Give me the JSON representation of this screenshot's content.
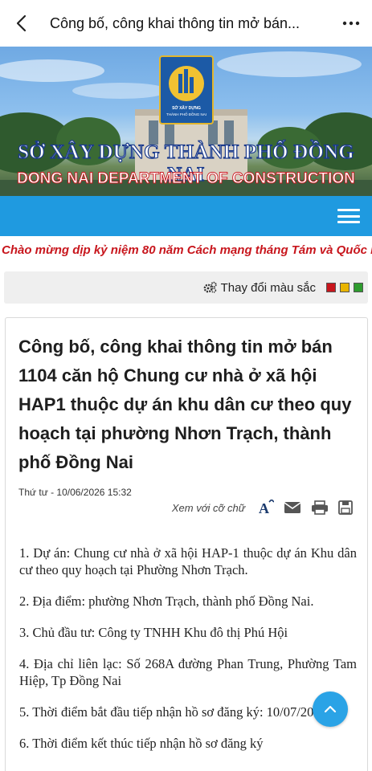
{
  "appbar": {
    "title": "Công bố, công khai thông tin mở bán...",
    "back_icon": "chevron-left-icon",
    "more_icon": "more-horizontal-icon"
  },
  "banner": {
    "logo_text": "SỞ XÂY DỰNG THÀNH PHỐ ĐỒNG NAI",
    "title_vn": "SỞ XÂY DỰNG THÀNH PHỐ ĐỒNG NAI",
    "title_en": "DONG NAI DEPARTMENT OF CONSTRUCTION"
  },
  "navbar": {
    "menu_icon": "hamburger-menu-icon"
  },
  "marquee": {
    "text": "Chào mừng dịp kỷ niệm 80 năm Cách mạng tháng Tám và Quốc l"
  },
  "color_bar": {
    "label": "Thay đổi màu sắc",
    "swatches": [
      "#c8161d",
      "#e8b400",
      "#2e9c2e"
    ]
  },
  "article": {
    "title": "Công bố, công khai thông tin mở bán 1104 căn hộ Chung cư nhà ở xã hội HAP1 thuộc dự án khu dân cư theo quy hoạch tại phường Nhơn Trạch, thành phố Đồng Nai",
    "date": "Thứ tư - 10/06/2026 15:32",
    "font_size_label": "Xem với cỡ chữ",
    "paragraphs": [
      "1. Dự án: Chung cư nhà ở xã hội HAP-1 thuộc dự án Khu dân cư theo quy hoạch tại Phường Nhơn Trạch.",
      "2. Địa điểm: phường Nhơn Trạch, thành phố Đồng Nai.",
      "3. Chủ đầu tư: Công ty TNHH Khu đô thị Phú Hội",
      "4. Địa chỉ liên lạc: Số 268A đường Phan Trung, Phường Tam Hiệp, Tp Đồng Nai",
      "5. Thời điểm bắt đầu tiếp nhận hồ sơ đăng ký: 10/07/2026",
      "6. Thời điểm kết thúc tiếp nhận hồ sơ đăng ký"
    ]
  }
}
